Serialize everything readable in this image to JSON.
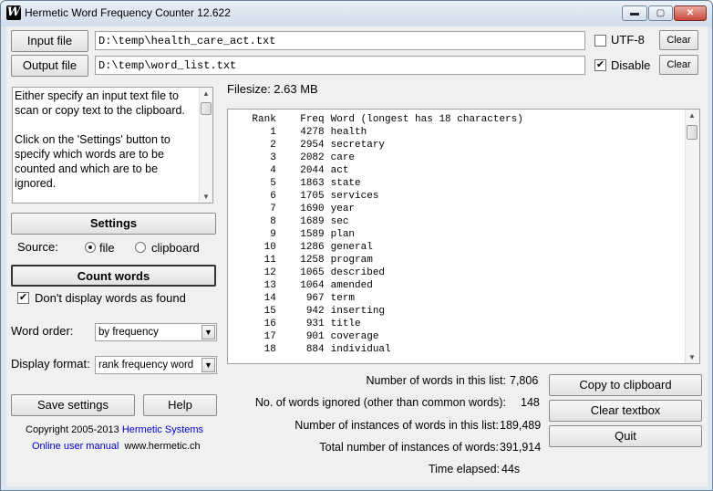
{
  "window": {
    "title": "Hermetic Word Frequency Counter 12.622"
  },
  "titlebar": {
    "minimize": "▬",
    "maximize": "▢",
    "close": "✕"
  },
  "input_file": {
    "button": "Input file",
    "path": "D:\\temp\\health_care_act.txt",
    "utf8_label": "UTF-8",
    "utf8_checked": false,
    "clear": "Clear"
  },
  "output_file": {
    "button": "Output file",
    "path": "D:\\temp\\word_list.txt",
    "disable_label": "Disable",
    "disable_checked": true,
    "clear": "Clear"
  },
  "info_text": "Either specify an input text file to scan or copy text to the clipboard.\n\nClick on the 'Settings' button to specify which words are to be counted and which are to be ignored.",
  "filesize": "Filesize: 2.63 MB",
  "settings_button": "Settings",
  "source": {
    "label": "Source:",
    "file": "file",
    "clipboard": "clipboard",
    "selected": "file"
  },
  "count_words_button": "Count words",
  "dont_display": {
    "label": "Don't display words as found",
    "checked": true
  },
  "word_order": {
    "label": "Word order:",
    "value": "by frequency"
  },
  "display_format": {
    "label": "Display format:",
    "value": "rank frequency word"
  },
  "save_settings_button": "Save settings",
  "help_button": "Help",
  "copyright": {
    "text": "Copyright 2005-2013",
    "company": "Hermetic Systems"
  },
  "manual_link": "Online user manual",
  "website": "www.hermetic.ch",
  "results": {
    "header": {
      "rank": "Rank",
      "freq": "Freq",
      "word": "Word (longest has 18 characters)"
    },
    "rows": [
      {
        "rank": "1",
        "freq": "4278",
        "word": "health"
      },
      {
        "rank": "2",
        "freq": "2954",
        "word": "secretary"
      },
      {
        "rank": "3",
        "freq": "2082",
        "word": "care"
      },
      {
        "rank": "4",
        "freq": "2044",
        "word": "act"
      },
      {
        "rank": "5",
        "freq": "1863",
        "word": "state"
      },
      {
        "rank": "6",
        "freq": "1705",
        "word": "services"
      },
      {
        "rank": "7",
        "freq": "1690",
        "word": "year"
      },
      {
        "rank": "8",
        "freq": "1689",
        "word": "sec"
      },
      {
        "rank": "9",
        "freq": "1589",
        "word": "plan"
      },
      {
        "rank": "10",
        "freq": "1286",
        "word": "general"
      },
      {
        "rank": "11",
        "freq": "1258",
        "word": "program"
      },
      {
        "rank": "12",
        "freq": "1065",
        "word": "described"
      },
      {
        "rank": "13",
        "freq": "1064",
        "word": "amended"
      },
      {
        "rank": "14",
        "freq": "967",
        "word": "term"
      },
      {
        "rank": "15",
        "freq": "942",
        "word": "inserting"
      },
      {
        "rank": "16",
        "freq": "931",
        "word": "title"
      },
      {
        "rank": "17",
        "freq": "901",
        "word": "coverage"
      },
      {
        "rank": "18",
        "freq": "884",
        "word": "individual"
      }
    ]
  },
  "stats": {
    "words_in_list_label": "Number of words in this list:",
    "words_in_list": "7,806",
    "ignored_label": "No. of words ignored (other than common words):",
    "ignored": "148",
    "instances_label": "Number of instances of words in this list:",
    "instances": "189,489",
    "total_label": "Total number of instances of words:",
    "total": "391,914",
    "elapsed_label": "Time elapsed:",
    "elapsed": "44s"
  },
  "copy_button": "Copy to clipboard",
  "clear_textbox_button": "Clear textbox",
  "quit_button": "Quit"
}
